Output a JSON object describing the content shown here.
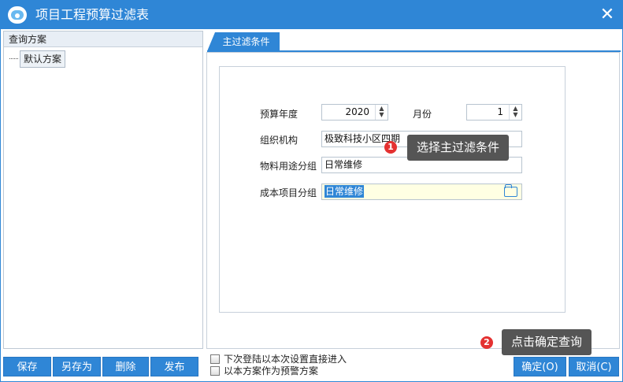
{
  "window": {
    "title": "项目工程预算过滤表",
    "close_glyph": "✕"
  },
  "left_panel": {
    "header": "查询方案",
    "tree_items": [
      {
        "label": "默认方案"
      }
    ]
  },
  "tab": {
    "label": "主过滤条件"
  },
  "form": {
    "budget_year": {
      "label": "预算年度",
      "value": "2020"
    },
    "month": {
      "label": "月份",
      "value": "1"
    },
    "organization": {
      "label": "组织机构",
      "value": "极致科技小区四期"
    },
    "material_group": {
      "label": "物料用途分组",
      "value": "日常维修"
    },
    "cost_group": {
      "label": "成本项目分组",
      "value": "日常维修"
    }
  },
  "callouts": {
    "first": {
      "number": "1",
      "text": "选择主过滤条件"
    },
    "second": {
      "number": "2",
      "text": "点击确定查询"
    }
  },
  "buttons": {
    "save": "保存",
    "save_as": "另存为",
    "delete": "删除",
    "publish": "发布",
    "ok": "确定(O)",
    "cancel": "取消(C)"
  },
  "options": {
    "direct_entry": "下次登陆以本次设置直接进入",
    "warning_plan": "以本方案作为预警方案"
  },
  "icons": {
    "app": "app-logo-icon",
    "close": "close-icon",
    "spinner": "spinner-icon",
    "folder": "folder-icon"
  },
  "colors": {
    "accent": "#2f86d6",
    "callout": "#555555",
    "badge": "#e43131",
    "focused_field": "#ffffe3"
  }
}
